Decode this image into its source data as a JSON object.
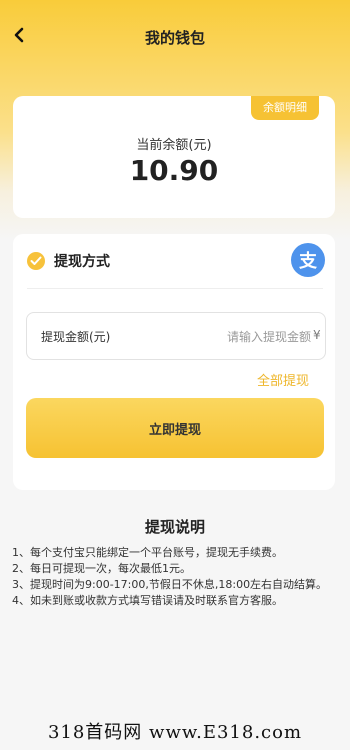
{
  "nav": {
    "title": "我的钱包",
    "back_icon": "chevron-left-icon"
  },
  "balance": {
    "tag_label": "余额明细",
    "label": "当前余额(元)",
    "value": "10.90"
  },
  "withdraw": {
    "method_label": "提现方式",
    "method_icon": "alipay-icon",
    "alipay_glyph": "支",
    "amount_label": "提现金额(元)",
    "amount_placeholder": "请输入提现金额",
    "amount_value": "",
    "currency_symbol": "¥",
    "withdraw_all_label": "全部提现",
    "submit_label": "立即提现"
  },
  "instructions": {
    "title": "提现说明",
    "items": [
      "1、每个支付宝只能绑定一个平台账号，提现无手续费。",
      "2、每日可提现一次，每次最低1元。",
      "3、提现时间为9:00-17:00,节假日不休息,18:00左右自动结算。",
      "4、如未到账或收款方式填写错误请及时联系官方客服。"
    ]
  },
  "watermark": "318首码网 www.E318.com",
  "colors": {
    "accent": "#f6c234",
    "alipay": "#4e93ec",
    "link": "#eeb62a"
  }
}
